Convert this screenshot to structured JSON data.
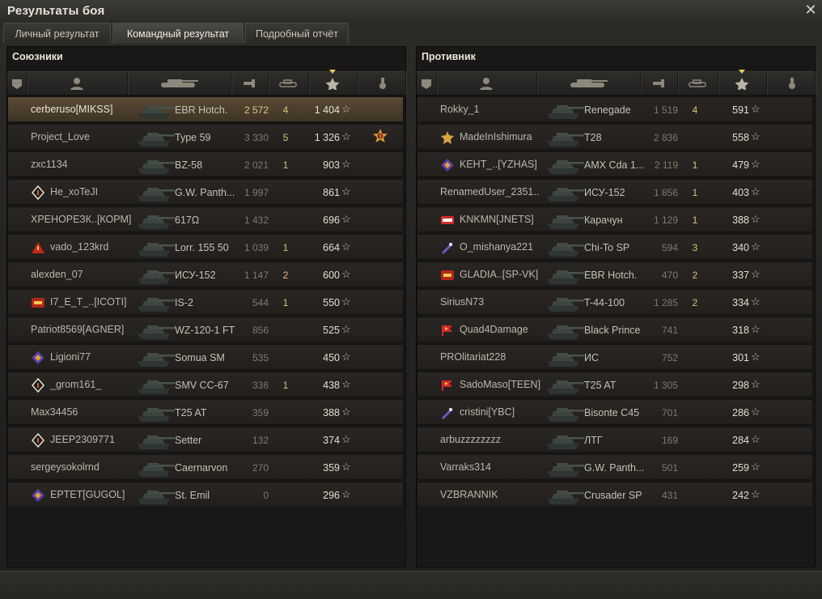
{
  "window": {
    "title": "Результаты боя",
    "close_icon": "close-icon"
  },
  "tabs": [
    {
      "label": "Личный результат",
      "active": false
    },
    {
      "label": "Командный результат",
      "active": true
    },
    {
      "label": "Подробный отчёт",
      "active": false
    }
  ],
  "columns": [
    "squad-icon",
    "player-icon",
    "tank-icon",
    "damage-icon",
    "kills-icon",
    "xp-star-icon",
    "medal-icon"
  ],
  "allies": {
    "title": "Союзники",
    "rows": [
      {
        "player": "cerberuso[MIKSS]",
        "badge": "",
        "tank": "EBR Hotch.",
        "damage": "2 572",
        "kills": "4",
        "xp": "1 404",
        "self": true,
        "medal": false
      },
      {
        "player": "Project_Love",
        "badge": "",
        "tank": "Type 59",
        "damage": "3 330",
        "kills": "5",
        "xp": "1 326",
        "self": false,
        "medal": true
      },
      {
        "player": "zxc1134",
        "badge": "",
        "tank": "BZ-58",
        "damage": "2 021",
        "kills": "1",
        "xp": "903",
        "self": false,
        "medal": false
      },
      {
        "player": "He_xoTeJI",
        "badge": "diamond",
        "tank": "G.W. Panth...",
        "damage": "1 997",
        "kills": "",
        "xp": "861",
        "self": false,
        "medal": false
      },
      {
        "player": "ХРЕНОРЕЗК..[КОРМ]",
        "badge": "",
        "tank": "617Ω",
        "damage": "1 432",
        "kills": "",
        "xp": "696",
        "self": false,
        "medal": false
      },
      {
        "player": "vado_123krd",
        "badge": "triangle",
        "tank": "Lorr. 155 50",
        "damage": "1 039",
        "kills": "1",
        "xp": "664",
        "self": false,
        "medal": false
      },
      {
        "player": "alexden_07",
        "badge": "",
        "tank": "ИСУ-152",
        "damage": "1 147",
        "kills": "2",
        "xp": "600",
        "self": false,
        "medal": false
      },
      {
        "player": "I7_E_T_..[ICOTI]",
        "badge": "red",
        "tank": "IS-2",
        "damage": "544",
        "kills": "1",
        "xp": "550",
        "self": false,
        "medal": false
      },
      {
        "player": "Patriot8569[AGNER]",
        "badge": "",
        "tank": "WZ-120-1 FT",
        "damage": "856",
        "kills": "",
        "xp": "525",
        "self": false,
        "medal": false
      },
      {
        "player": "Ligioni77",
        "badge": "purple",
        "tank": "Somua SM",
        "damage": "535",
        "kills": "",
        "xp": "450",
        "self": false,
        "medal": false
      },
      {
        "player": "_grom161_",
        "badge": "diamond",
        "tank": "SMV CC-67",
        "damage": "336",
        "kills": "1",
        "xp": "438",
        "self": false,
        "medal": false
      },
      {
        "player": "Max34456",
        "badge": "",
        "tank": "T25 AT",
        "damage": "359",
        "kills": "",
        "xp": "388",
        "self": false,
        "medal": false
      },
      {
        "player": "JEEP2309771",
        "badge": "diamond",
        "tank": "Setter",
        "damage": "132",
        "kills": "",
        "xp": "374",
        "self": false,
        "medal": false
      },
      {
        "player": "sergeysokolrnd",
        "badge": "",
        "tank": "Caernarvon",
        "damage": "270",
        "kills": "",
        "xp": "359",
        "self": false,
        "medal": false
      },
      {
        "player": "EPTET[GUGOL]",
        "badge": "purple",
        "tank": "St. Emil",
        "damage": "0",
        "kills": "",
        "xp": "296",
        "self": false,
        "medal": false
      }
    ]
  },
  "enemies": {
    "title": "Противник",
    "rows": [
      {
        "player": "Rokky_1",
        "badge": "",
        "tank": "Renegade",
        "damage": "1 519",
        "kills": "4",
        "xp": "591"
      },
      {
        "player": "MadeInIshimura",
        "badge": "gold",
        "tank": "T28",
        "damage": "2 836",
        "kills": "",
        "xp": "558"
      },
      {
        "player": "KEHT_..[YZHAS]",
        "badge": "purple",
        "tank": "AMX Cda 1...",
        "damage": "2 119",
        "kills": "1",
        "xp": "479"
      },
      {
        "player": "RenamedUser_2351..",
        "badge": "",
        "tank": "ИСУ-152",
        "damage": "1 856",
        "kills": "1",
        "xp": "403"
      },
      {
        "player": "KNKMN[JNETS]",
        "badge": "lebwa",
        "tank": "Карачун",
        "damage": "1 129",
        "kills": "1",
        "xp": "388"
      },
      {
        "player": "O_mishanya221",
        "badge": "rocket",
        "tank": "Chi-To SP",
        "damage": "594",
        "kills": "3",
        "xp": "340"
      },
      {
        "player": "GLADIA..[SP-VK]",
        "badge": "red",
        "tank": "EBR Hotch.",
        "damage": "470",
        "kills": "2",
        "xp": "337"
      },
      {
        "player": "SiriusN73",
        "badge": "",
        "tank": "T-44-100",
        "damage": "1 285",
        "kills": "2",
        "xp": "334"
      },
      {
        "player": "Quad4Damage",
        "badge": "flag",
        "tank": "Black Prince",
        "damage": "741",
        "kills": "",
        "xp": "318"
      },
      {
        "player": "PROlitariat228",
        "badge": "",
        "tank": "ИС",
        "damage": "752",
        "kills": "",
        "xp": "301"
      },
      {
        "player": "SadoMaso[TEEN]",
        "badge": "flag",
        "tank": "T25 AT",
        "damage": "1 305",
        "kills": "",
        "xp": "298"
      },
      {
        "player": "cristini[YBC]",
        "badge": "rocket",
        "tank": "Bisonte C45",
        "damage": "701",
        "kills": "",
        "xp": "286"
      },
      {
        "player": "arbuzzzzzzzz",
        "badge": "",
        "tank": "ЛТГ",
        "damage": "169",
        "kills": "",
        "xp": "284"
      },
      {
        "player": "Varraks314",
        "badge": "",
        "tank": "G.W. Panth...",
        "damage": "501",
        "kills": "",
        "xp": "259"
      },
      {
        "player": "VZBRANNIK",
        "badge": "",
        "tank": "Crusader SP",
        "damage": "431",
        "kills": "",
        "xp": "242"
      }
    ]
  },
  "colors": {
    "accent": "#e8c860",
    "self_row": "#5a4a35",
    "kills": "#d9c27a"
  }
}
